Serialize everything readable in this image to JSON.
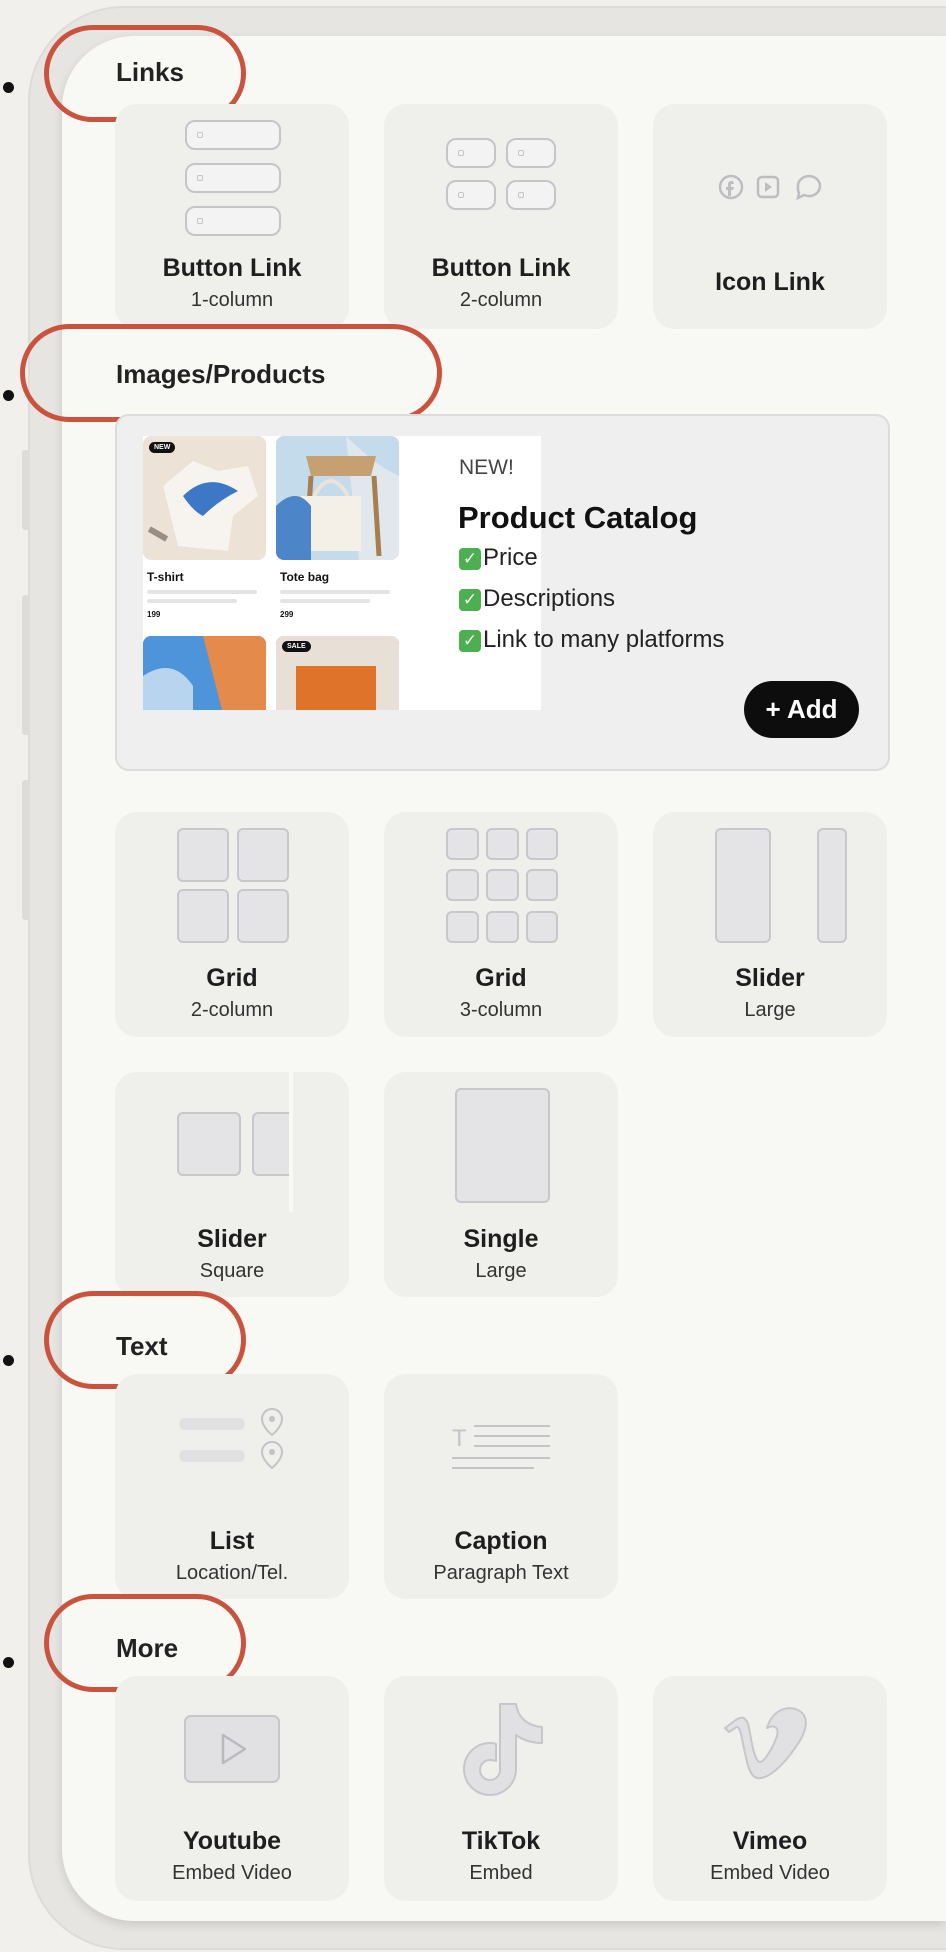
{
  "sections": {
    "links": "Links",
    "images": "Images/Products",
    "text": "Text",
    "more": "More"
  },
  "links_tiles": [
    {
      "title": "Button Link",
      "sub": "1-column",
      "icon": "button-link-1col-icon"
    },
    {
      "title": "Button Link",
      "sub": "2-column",
      "icon": "button-link-2col-icon"
    },
    {
      "title": "Icon Link",
      "sub": "",
      "icon": "social-icons-icon"
    }
  ],
  "product_card": {
    "tag": "NEW!",
    "title": "Product Catalog",
    "features": [
      "Price",
      "Descriptions",
      "Link to many platforms"
    ],
    "add_button": "+ Add",
    "thumb1_label": "T-shirt",
    "thumb1_price": "199",
    "thumb2_label": "Tote bag",
    "thumb2_price": "299",
    "badge_new": "NEW",
    "badge_sale": "SALE"
  },
  "image_tiles": [
    {
      "title": "Grid",
      "sub": "2-column"
    },
    {
      "title": "Grid",
      "sub": "3-column"
    },
    {
      "title": "Slider",
      "sub": "Large"
    },
    {
      "title": "Slider",
      "sub": "Square"
    },
    {
      "title": "Single",
      "sub": "Large"
    }
  ],
  "text_tiles": [
    {
      "title": "List",
      "sub": "Location/Tel."
    },
    {
      "title": "Caption",
      "sub": "Paragraph Text"
    }
  ],
  "more_tiles": [
    {
      "title": "Youtube",
      "sub": "Embed Video"
    },
    {
      "title": "TikTok",
      "sub": "Embed"
    },
    {
      "title": "Vimeo",
      "sub": "Embed Video"
    }
  ],
  "colors": {
    "highlight_ring": "#c9533d",
    "check_green": "#4caf50",
    "add_button": "#0d0d0d"
  }
}
